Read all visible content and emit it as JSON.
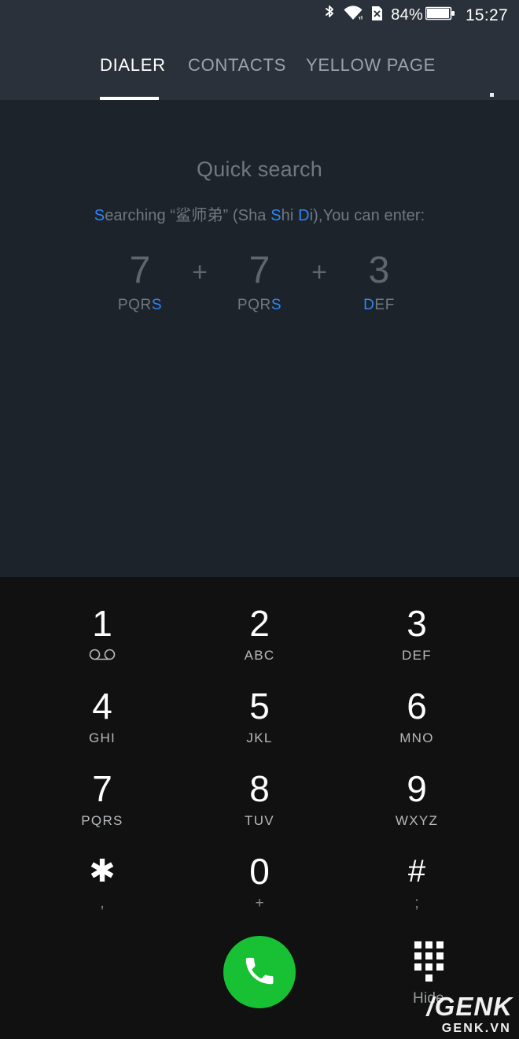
{
  "statusbar": {
    "bluetooth_icon": "bluetooth-icon",
    "wifi_icon": "wifi-icon",
    "sim_icon": "no-sim-icon",
    "battery_percent": "84%",
    "battery_icon": "battery-icon",
    "clock": "15:27"
  },
  "tabs": {
    "items": [
      {
        "label": "DIALER",
        "active": true
      },
      {
        "label": "CONTACTS",
        "active": false
      },
      {
        "label": "YELLOW PAGE",
        "active": false
      }
    ],
    "overflow_icon": "overflow-menu-icon"
  },
  "search": {
    "title": "Quick search",
    "hint_prefix_hl": "S",
    "hint_prefix_rest": "earching ",
    "hint_quote_open": "“",
    "hint_cjk": "鲨师弟",
    "hint_quote_close": "”",
    "hint_paren_open": " (Sha ",
    "hint_s1": "S",
    "hint_hi": "hi ",
    "hint_d": "D",
    "hint_i": "i",
    "hint_tail": "),You can enter:",
    "hint_digits": [
      {
        "digit": "7",
        "letters_plain": "PQR",
        "letters_hl": "S"
      },
      {
        "digit": "7",
        "letters_plain": "PQR",
        "letters_hl": "S"
      },
      {
        "digit": "3",
        "letters_hl": "D",
        "letters_plain2": "EF"
      }
    ],
    "separator": "+"
  },
  "keypad": {
    "keys": [
      {
        "digit": "1",
        "sub": "",
        "icon": "voicemail-icon"
      },
      {
        "digit": "2",
        "sub": "ABC"
      },
      {
        "digit": "3",
        "sub": "DEF"
      },
      {
        "digit": "4",
        "sub": "GHI"
      },
      {
        "digit": "5",
        "sub": "JKL"
      },
      {
        "digit": "6",
        "sub": "MNO"
      },
      {
        "digit": "7",
        "sub": "PQRS"
      },
      {
        "digit": "8",
        "sub": "TUV"
      },
      {
        "digit": "9",
        "sub": "WXYZ"
      },
      {
        "digit": "✱",
        "sub": ","
      },
      {
        "digit": "0",
        "sub": "+"
      },
      {
        "digit": "#",
        "sub": ";"
      }
    ]
  },
  "actions": {
    "call_icon": "phone-call-icon",
    "hide_icon": "dialpad-icon",
    "hide_label": "Hide"
  },
  "watermark": {
    "main": "/GENK",
    "sub": "GENK.VN"
  },
  "colors": {
    "header_bg": "#2a313a",
    "panel_bg": "#1c232b",
    "keypad_bg": "#111111",
    "accent_blue": "#2f86f5",
    "call_green": "#18c034",
    "muted_text": "#6f7880",
    "key_text": "#ffffff"
  }
}
